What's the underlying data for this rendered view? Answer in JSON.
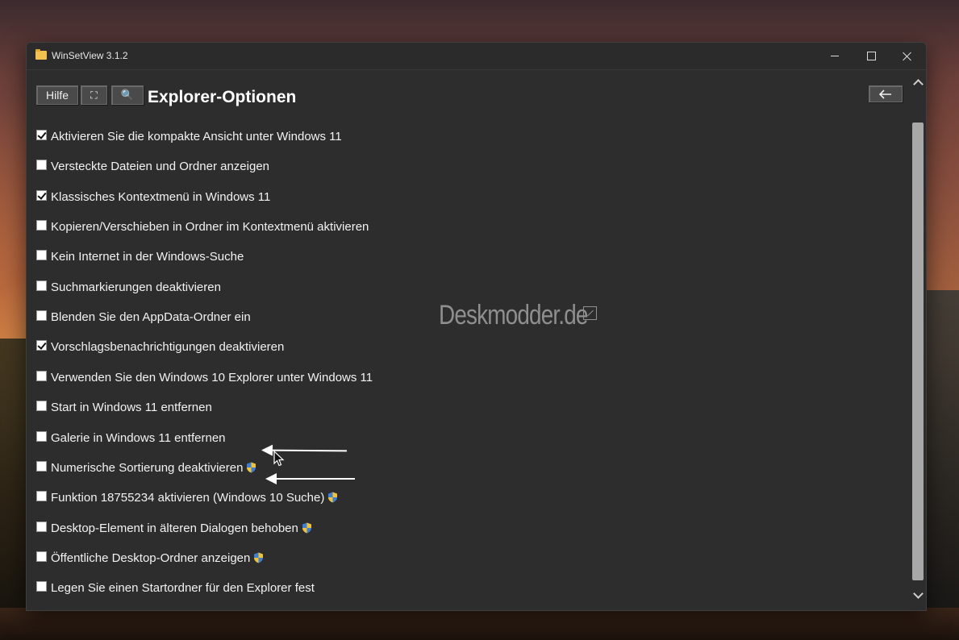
{
  "window": {
    "title": "WinSetView 3.1.2"
  },
  "toolbar": {
    "help_label": "Hilfe",
    "fullscreen_glyph": "⛶",
    "search_glyph": "🔍",
    "back_glyph": "🡐"
  },
  "page": {
    "title": "Explorer-Optionen"
  },
  "options": [
    {
      "label": "Aktivieren Sie die kompakte Ansicht unter Windows 11",
      "checked": true,
      "admin": false
    },
    {
      "label": "Versteckte Dateien und Ordner anzeigen",
      "checked": false,
      "admin": false
    },
    {
      "label": "Klassisches Kontextmenü in Windows 11",
      "checked": true,
      "admin": false
    },
    {
      "label": "Kopieren/Verschieben in Ordner im Kontextmenü aktivieren",
      "checked": false,
      "admin": false
    },
    {
      "label": "Kein Internet in der Windows-Suche",
      "checked": false,
      "admin": false
    },
    {
      "label": "Suchmarkierungen deaktivieren",
      "checked": false,
      "admin": false
    },
    {
      "label": "Blenden Sie den AppData-Ordner ein",
      "checked": false,
      "admin": false
    },
    {
      "label": "Vorschlagsbenachrichtigungen deaktivieren",
      "checked": true,
      "admin": false
    },
    {
      "label": "Verwenden Sie den Windows 10 Explorer unter Windows 11",
      "checked": false,
      "admin": false
    },
    {
      "label": "Start in Windows 11 entfernen",
      "checked": false,
      "admin": false
    },
    {
      "label": "Galerie in Windows 11 entfernen",
      "checked": false,
      "admin": false
    },
    {
      "label": "Numerische Sortierung deaktivieren",
      "checked": false,
      "admin": true
    },
    {
      "label": "Funktion 18755234 aktivieren (Windows 10 Suche)",
      "checked": false,
      "admin": true
    },
    {
      "label": "Desktop-Element in älteren Dialogen behoben",
      "checked": false,
      "admin": true
    },
    {
      "label": "Öffentliche Desktop-Ordner anzeigen",
      "checked": false,
      "admin": true
    },
    {
      "label": "Legen Sie einen Startordner für den Explorer fest",
      "checked": false,
      "admin": false
    }
  ],
  "watermark": {
    "text": "Deskmodder.de"
  },
  "icons": {
    "app": "folder-icon",
    "admin": "uac-shield-icon",
    "back": "arrow-left-icon"
  }
}
